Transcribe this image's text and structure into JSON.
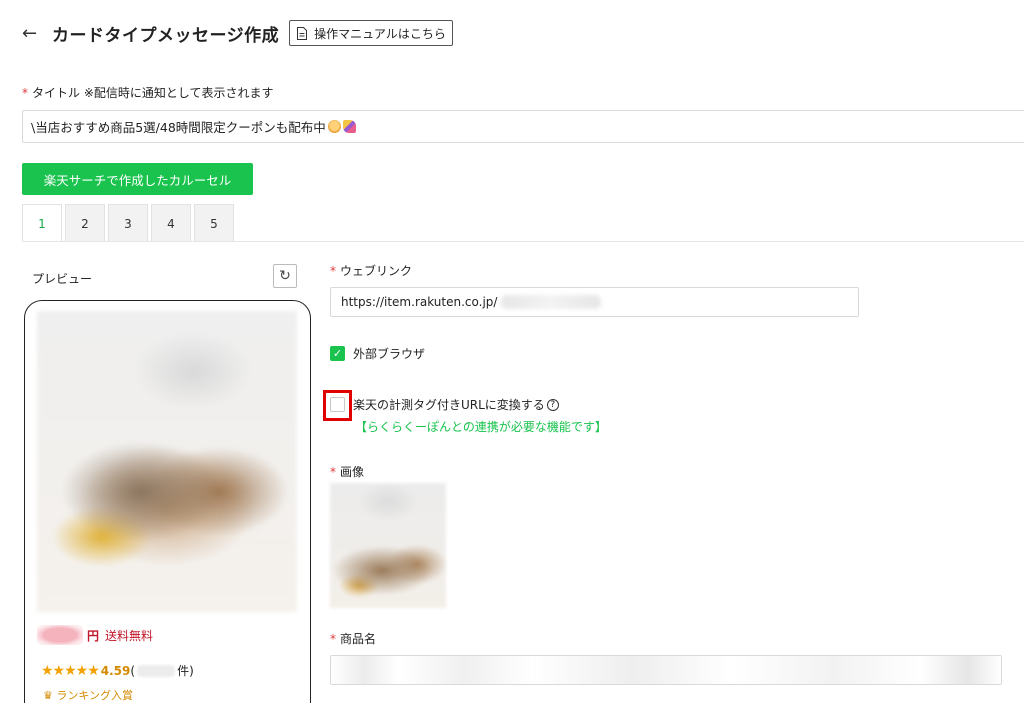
{
  "header": {
    "back_icon": "arrow-left-icon",
    "title": "カードタイプメッセージ作成",
    "manual_button": "操作マニュアルはこちら"
  },
  "title_field": {
    "required_mark": "*",
    "label": "タイトル ※配信時に通知として表示されます",
    "value": "\\当店おすすめ商品5選/48時間限定クーポンも配布中"
  },
  "carousel_button": "楽天サーチで作成したカルーセル",
  "tabs": [
    "1",
    "2",
    "3",
    "4",
    "5"
  ],
  "active_tab": "1",
  "preview": {
    "label": "プレビュー",
    "refresh_icon": "refresh-icon",
    "price_unit": "円",
    "shipping": "送料無料",
    "stars": "★★★★★",
    "rating": "4.59",
    "count_open": "(",
    "count_close": "件)",
    "ranking": "ランキング入賞",
    "ranking_icon": "crown-icon"
  },
  "weblink": {
    "label": "ウェブリンク",
    "value": "https://item.rakuten.co.jp/"
  },
  "external_browser": {
    "label": "外部ブラウザ",
    "checked": true
  },
  "convert_url": {
    "label": "楽天の計測タグ付きURLに変換する",
    "checked": false,
    "note": "【らくらくーぽんとの連携が必要な機能です】"
  },
  "image_field": {
    "label": "画像"
  },
  "product_name": {
    "label": "商品名"
  },
  "colors": {
    "accent_green": "#19c34d",
    "required_red": "#e03a3a",
    "price_red": "#c2182b",
    "highlight_red": "#e00000"
  }
}
